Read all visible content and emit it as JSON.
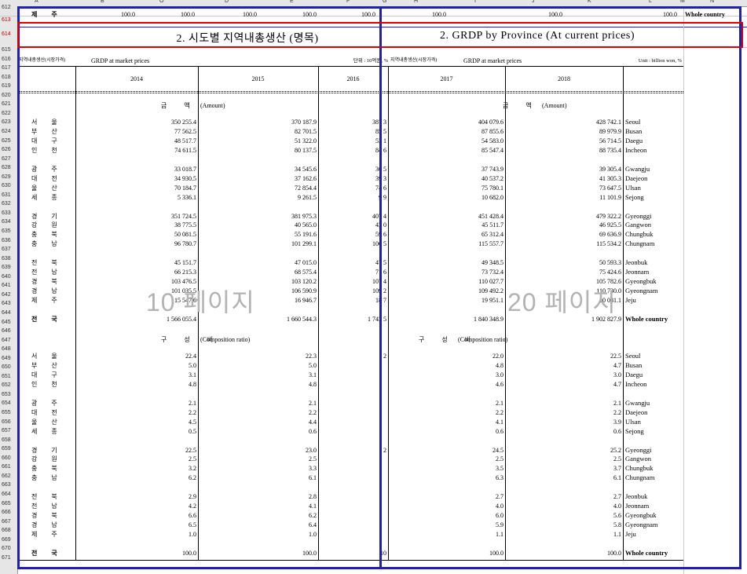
{
  "columns": [
    "A",
    "B",
    "O",
    "D",
    "E",
    "F",
    "G",
    "H",
    "I",
    "J",
    "K",
    "L",
    "M",
    "N"
  ],
  "row_numbers": [
    "612",
    "613",
    "614",
    "615",
    "616",
    "617",
    "618",
    "619",
    "620",
    "621",
    "622",
    "623",
    "624",
    "625",
    "626",
    "627",
    "628",
    "629",
    "630",
    "631",
    "632",
    "633",
    "634",
    "635",
    "636",
    "637",
    "638",
    "639",
    "640",
    "641",
    "642",
    "643",
    "644",
    "645",
    "646",
    "647",
    "648",
    "649",
    "650",
    "651",
    "652",
    "653",
    "654",
    "655",
    "656",
    "657",
    "658",
    "659",
    "660",
    "661",
    "662",
    "663",
    "664",
    "665",
    "666",
    "667",
    "668",
    "669",
    "670",
    "671"
  ],
  "top_row": {
    "ko": "제 주",
    "vals": [
      "100.0",
      "100.0",
      "100.0",
      "100.0",
      "100.0",
      "100.0",
      "100.0",
      "100.0"
    ],
    "en": "Whole country"
  },
  "titles": {
    "left": "2. 시도별 지역내총생산 (명목)",
    "right": "2. GRDP by Province (At current prices)"
  },
  "subheader": {
    "left_ko": "지역내총생산(시장가격)",
    "left_en": "GRDP at market prices",
    "unit_left": "단위 : 10억원, %",
    "right_ko": "지역내총생산(시장가격)",
    "right_en": "GRDP at market prices",
    "unit_right": "Unit : billion won, %"
  },
  "years": [
    "2014",
    "2015",
    "2016",
    "2017",
    "2018"
  ],
  "section_amount": {
    "ko": "금 액",
    "en": "(Amount)"
  },
  "section_ratio": {
    "ko": "구 성 비",
    "en": "(Composition ratio)"
  },
  "watermark": {
    "left": "10 페이지",
    "right": "20 페이지"
  },
  "amount_rows": [
    {
      "ko": "서 울",
      "en": "Seoul",
      "v": [
        "350 255.4",
        "370 187.9",
        "387 3",
        "404 079.6",
        "428 742.1"
      ]
    },
    {
      "ko": "부 산",
      "en": "Busan",
      "v": [
        "77 562.5",
        "82 701.5",
        "85 5",
        "87 855.6",
        "89 979.9"
      ]
    },
    {
      "ko": "대 구",
      "en": "Daegu",
      "v": [
        "48 517.7",
        "51 322.0",
        "53 1",
        "54 583.0",
        "56 714.5"
      ]
    },
    {
      "ko": "인 천",
      "en": "Incheon",
      "v": [
        "74 611.5",
        "80 137.5",
        "84 6",
        "85 547.4",
        "88 735.4"
      ]
    },
    {
      "ko": "",
      "en": "",
      "v": [
        "",
        "",
        "",
        "",
        ""
      ]
    },
    {
      "ko": "광 주",
      "en": "Gwangju",
      "v": [
        "33 018.7",
        "34 545.6",
        "36 5",
        "37 743.9",
        "39 305.4"
      ]
    },
    {
      "ko": "대 전",
      "en": "Daejeon",
      "v": [
        "34 930.5",
        "37 162.6",
        "39 3",
        "40 537.2",
        "41 305.3"
      ]
    },
    {
      "ko": "울 산",
      "en": "Ulsan",
      "v": [
        "70 184.7",
        "72 854.4",
        "74 6",
        "75 780.1",
        "73 647.5"
      ]
    },
    {
      "ko": "세 종",
      "en": "Sejong",
      "v": [
        "5 336.1",
        "9 261.5",
        "9 9",
        "10 682.0",
        "11 101.9"
      ]
    },
    {
      "ko": "",
      "en": "",
      "v": [
        "",
        "",
        "",
        "",
        ""
      ]
    },
    {
      "ko": "경 기",
      "en": "Gyeonggi",
      "v": [
        "351 724.5",
        "381 975.3",
        "407 4",
        "451 428.4",
        "479 322.2"
      ]
    },
    {
      "ko": "강 원",
      "en": "Gangwon",
      "v": [
        "38 775.5",
        "40 565.0",
        "43 0",
        "45 511.7",
        "46 925.5"
      ]
    },
    {
      "ko": "충 북",
      "en": "Chungbuk",
      "v": [
        "50 081.5",
        "55 191.6",
        "59 6",
        "65 312.4",
        "69 636.9"
      ]
    },
    {
      "ko": "충 남",
      "en": "Chungnam",
      "v": [
        "96 780.7",
        "101 299.1",
        "106 5",
        "115 557.7",
        "115 534.2"
      ]
    },
    {
      "ko": "",
      "en": "",
      "v": [
        "",
        "",
        "",
        "",
        ""
      ]
    },
    {
      "ko": "전 북",
      "en": "Jeonbuk",
      "v": [
        "45 151.7",
        "47 015.0",
        "47 5",
        "49 348.5",
        "50 593.3"
      ]
    },
    {
      "ko": "전 남",
      "en": "Jeonnam",
      "v": [
        "66 215.3",
        "68 575.4",
        "71 6",
        "73 732.4",
        "75 424.6"
      ]
    },
    {
      "ko": "경 북",
      "en": "Gyeongbuk",
      "v": [
        "103 476.5",
        "103 120.2",
        "107 4",
        "110 027.7",
        "105 782.6"
      ]
    },
    {
      "ko": "경 남",
      "en": "Gyeongnam",
      "v": [
        "101 035.5",
        "106 590.9",
        "109 2",
        "109 492.2",
        "110 730.0"
      ]
    },
    {
      "ko": "제 주",
      "en": "Jeju",
      "v": [
        "15 547.6",
        "16 946.7",
        "18 7",
        "19 951.1",
        "20 081.1"
      ]
    },
    {
      "ko": "",
      "en": "",
      "v": [
        "",
        "",
        "",
        "",
        ""
      ]
    },
    {
      "ko": "전 국",
      "en": "Whole country",
      "v": [
        "1 566 055.4",
        "1 660 544.3",
        "1 743 5",
        "1 840 348.9",
        "1 902 827.9"
      ],
      "bold": true
    }
  ],
  "ratio_rows": [
    {
      "ko": "서 울",
      "en": "Seoul",
      "v": [
        "22.4",
        "22.3",
        "2",
        "22.0",
        "22.5"
      ]
    },
    {
      "ko": "부 산",
      "en": "Busan",
      "v": [
        "5.0",
        "5.0",
        "",
        "4.8",
        "4.7"
      ]
    },
    {
      "ko": "대 구",
      "en": "Daegu",
      "v": [
        "3.1",
        "3.1",
        "",
        "3.0",
        "3.0"
      ]
    },
    {
      "ko": "인 천",
      "en": "Incheon",
      "v": [
        "4.8",
        "4.8",
        "",
        "4.6",
        "4.7"
      ]
    },
    {
      "ko": "",
      "en": "",
      "v": [
        "",
        "",
        "",
        "",
        ""
      ]
    },
    {
      "ko": "광 주",
      "en": "Gwangju",
      "v": [
        "2.1",
        "2.1",
        "",
        "2.1",
        "2.1"
      ]
    },
    {
      "ko": "대 전",
      "en": "Daejeon",
      "v": [
        "2.2",
        "2.2",
        "",
        "2.2",
        "2.2"
      ]
    },
    {
      "ko": "울 산",
      "en": "Ulsan",
      "v": [
        "4.5",
        "4.4",
        "",
        "4.1",
        "3.9"
      ]
    },
    {
      "ko": "세 종",
      "en": "Sejong",
      "v": [
        "0.5",
        "0.6",
        "",
        "0.6",
        "0.6"
      ]
    },
    {
      "ko": "",
      "en": "",
      "v": [
        "",
        "",
        "",
        "",
        ""
      ]
    },
    {
      "ko": "경 기",
      "en": "Gyeonggi",
      "v": [
        "22.5",
        "23.0",
        "2",
        "24.5",
        "25.2"
      ]
    },
    {
      "ko": "강 원",
      "en": "Gangwon",
      "v": [
        "2.5",
        "2.5",
        "",
        "2.5",
        "2.5"
      ]
    },
    {
      "ko": "충 북",
      "en": "Chungbuk",
      "v": [
        "3.2",
        "3.3",
        "",
        "3.5",
        "3.7"
      ]
    },
    {
      "ko": "충 남",
      "en": "Chungnam",
      "v": [
        "6.2",
        "6.1",
        "",
        "6.3",
        "6.1"
      ]
    },
    {
      "ko": "",
      "en": "",
      "v": [
        "",
        "",
        "",
        "",
        ""
      ]
    },
    {
      "ko": "전 북",
      "en": "Jeonbuk",
      "v": [
        "2.9",
        "2.8",
        "",
        "2.7",
        "2.7"
      ]
    },
    {
      "ko": "전 남",
      "en": "Jeonnam",
      "v": [
        "4.2",
        "4.1",
        "",
        "4.0",
        "4.0"
      ]
    },
    {
      "ko": "경 북",
      "en": "Gyeongbuk",
      "v": [
        "6.6",
        "6.2",
        "",
        "6.0",
        "5.6"
      ]
    },
    {
      "ko": "경 남",
      "en": "Gyeongnam",
      "v": [
        "6.5",
        "6.4",
        "",
        "5.9",
        "5.8"
      ]
    },
    {
      "ko": "제 주",
      "en": "Jeju",
      "v": [
        "1.0",
        "1.0",
        "",
        "1.1",
        "1.1"
      ]
    },
    {
      "ko": "",
      "en": "",
      "v": [
        "",
        "",
        "",
        "",
        ""
      ]
    },
    {
      "ko": "전 국",
      "en": "Whole country",
      "v": [
        "100.0",
        "100.0",
        "10",
        "100.0",
        "100.0"
      ],
      "bold": true
    }
  ],
  "colors": {
    "page_break": "#1f1fb4",
    "selection": "#e00000",
    "header_bg": "#e6e6e6",
    "watermark": "#b3b3b3"
  }
}
